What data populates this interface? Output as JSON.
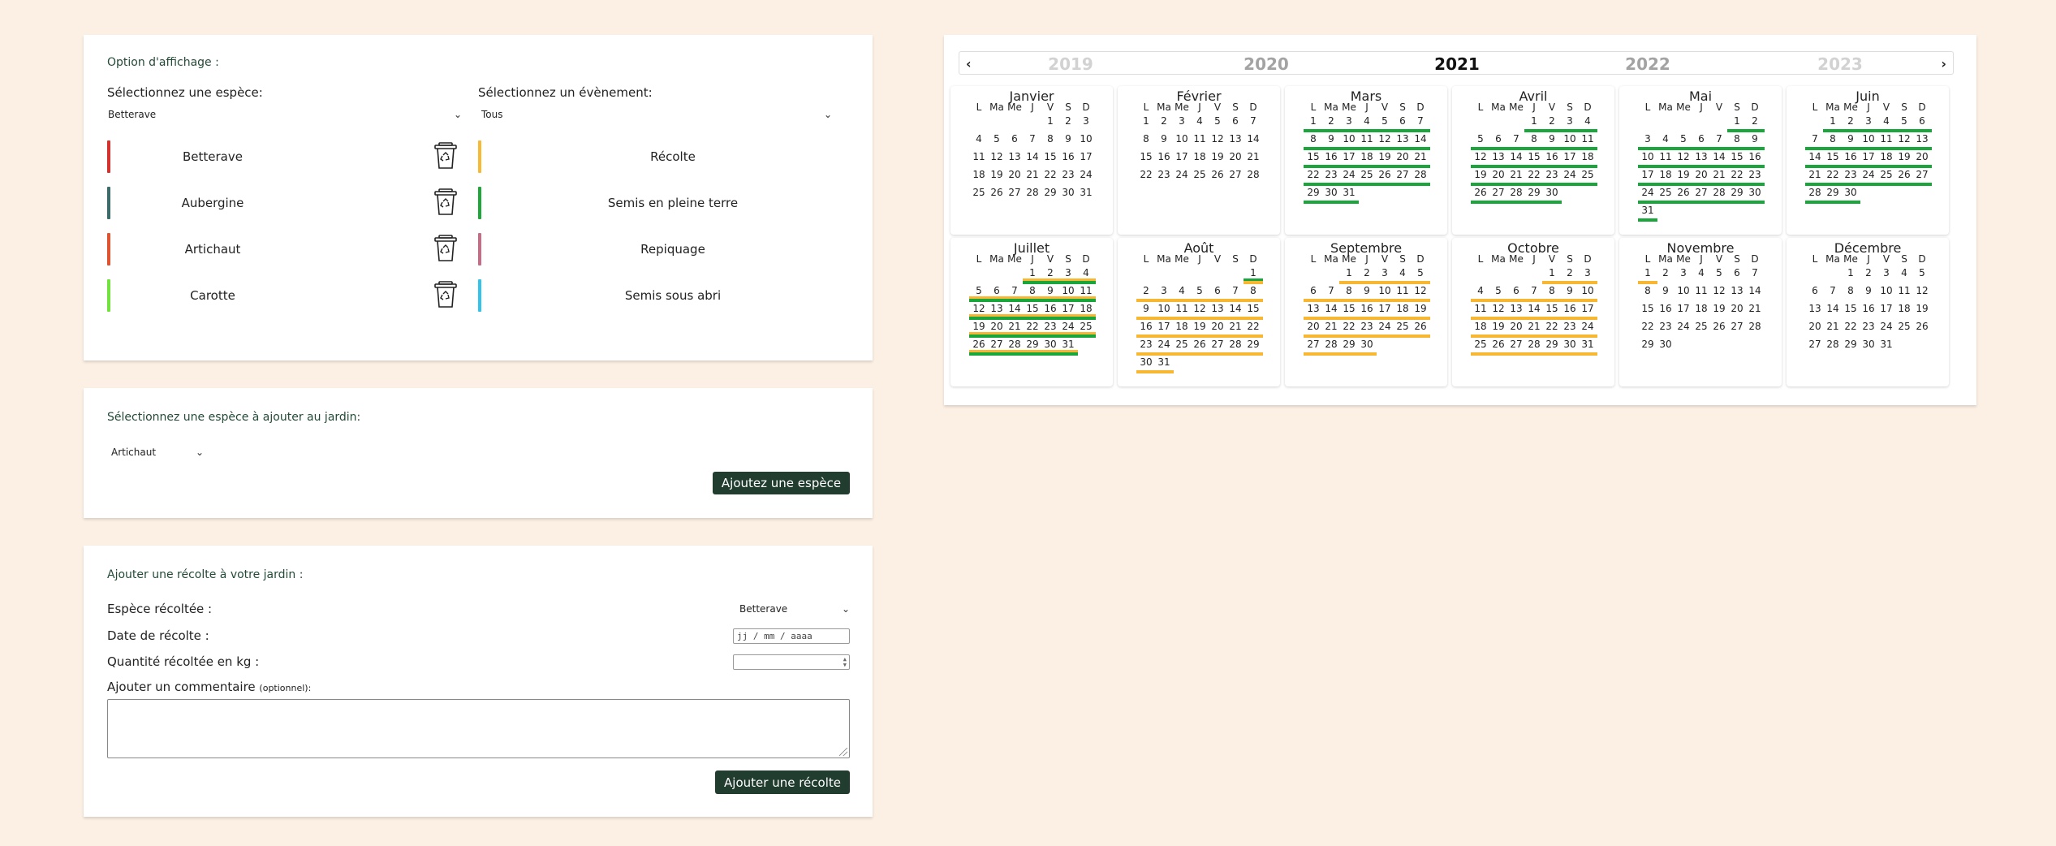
{
  "display": {
    "title": "Option d'affichage :",
    "species_label": "Sélectionnez une espèce:",
    "species_value": "Betterave",
    "event_label": "Sélectionnez un évènement:",
    "event_value": "Tous",
    "species": [
      {
        "name": "Betterave",
        "color": "#d3322f"
      },
      {
        "name": "Aubergine",
        "color": "#3c6b6a"
      },
      {
        "name": "Artichaut",
        "color": "#e05330"
      },
      {
        "name": "Carotte",
        "color": "#72e23e"
      }
    ],
    "events": [
      {
        "name": "Récolte",
        "color": "#f8b934"
      },
      {
        "name": "Semis en pleine terre",
        "color": "#1fa83a"
      },
      {
        "name": "Repiquage",
        "color": "#c96b86"
      },
      {
        "name": "Semis sous abri",
        "color": "#33c4ec"
      }
    ],
    "trash_icon": "trash-recycle-icon"
  },
  "add_species": {
    "title": "Sélectionnez une espèce à ajouter au jardin:",
    "select_value": "Artichaut",
    "button": "Ajoutez une espèce"
  },
  "harvest": {
    "title": "Ajouter une récolte à votre jardin :",
    "species_label": "Espèce récoltée :",
    "species_value": "Betterave",
    "date_label": "Date de récolte :",
    "date_placeholder": "jj / mm / aaaa",
    "qty_label": "Quantité récoltée en kg :",
    "comment_label": "Ajouter un commentaire",
    "comment_optional": "(optionnel):",
    "button": "Ajouter une récolte"
  },
  "calendar": {
    "prev": "‹",
    "next": "›",
    "years": [
      {
        "label": "2019",
        "color": "#d2d2d2"
      },
      {
        "label": "2020",
        "color": "#a3a3a3"
      },
      {
        "label": "2021",
        "color": "#111111"
      },
      {
        "label": "2022",
        "color": "#a3a3a3"
      },
      {
        "label": "2023",
        "color": "#d2d2d2"
      }
    ],
    "weekdays": [
      "L",
      "Ma",
      "Me",
      "J",
      "V",
      "S",
      "D"
    ],
    "colors": {
      "green": "#1aa63a",
      "orange": "#f7b733"
    },
    "months": [
      {
        "name": "Janvier",
        "offset": 4,
        "days": 31,
        "lines": []
      },
      {
        "name": "Février",
        "offset": 0,
        "days": 28,
        "lines": []
      },
      {
        "name": "Mars",
        "offset": 0,
        "days": 31,
        "lines": [
          [
            "green",
            1,
            31
          ]
        ]
      },
      {
        "name": "Avril",
        "offset": 3,
        "days": 30,
        "lines": [
          [
            "green",
            1,
            30
          ]
        ]
      },
      {
        "name": "Mai",
        "offset": 5,
        "days": 31,
        "lines": [
          [
            "green",
            1,
            31
          ]
        ]
      },
      {
        "name": "Juin",
        "offset": 1,
        "days": 30,
        "lines": [
          [
            "green",
            1,
            30
          ]
        ]
      },
      {
        "name": "Juillet",
        "offset": 3,
        "days": 31,
        "lines": [
          [
            "orange",
            1,
            31
          ],
          [
            "green",
            1,
            31
          ]
        ]
      },
      {
        "name": "Août",
        "offset": 6,
        "days": 31,
        "lines": [
          [
            "green",
            1,
            1
          ],
          [
            "orange",
            1,
            31
          ]
        ]
      },
      {
        "name": "Septembre",
        "offset": 2,
        "days": 30,
        "lines": [
          [
            "orange",
            1,
            30
          ]
        ]
      },
      {
        "name": "Octobre",
        "offset": 4,
        "days": 31,
        "lines": [
          [
            "orange",
            1,
            31
          ]
        ]
      },
      {
        "name": "Novembre",
        "offset": 0,
        "days": 30,
        "lines": [
          [
            "orange",
            1,
            1
          ]
        ]
      },
      {
        "name": "Décembre",
        "offset": 2,
        "days": 31,
        "lines": []
      }
    ]
  }
}
